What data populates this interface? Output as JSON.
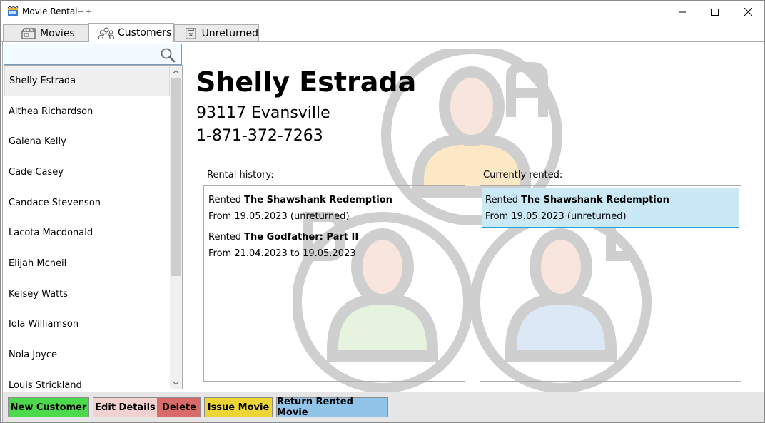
{
  "window": {
    "title": "Movie Rental++",
    "icon": "movie-rental-app-icon",
    "controls": [
      "minimize-icon",
      "maximize-icon",
      "close-icon"
    ]
  },
  "tabs": [
    {
      "label": "Movies",
      "icon": "movie-tab-icon",
      "active": false
    },
    {
      "label": "Customers",
      "icon": "customers-tab-icon",
      "active": true
    },
    {
      "label": "Unreturned",
      "icon": "unreturned-tab-icon",
      "active": false
    }
  ],
  "search": {
    "value": "",
    "placeholder": "",
    "icon": "search-icon"
  },
  "customers": [
    {
      "name": "Shelly Estrada",
      "selected": true
    },
    {
      "name": "Althea Richardson"
    },
    {
      "name": "Galena Kelly"
    },
    {
      "name": "Cade Casey"
    },
    {
      "name": "Candace Stevenson"
    },
    {
      "name": "Lacota Macdonald"
    },
    {
      "name": "Elijah Mcneil"
    },
    {
      "name": "Kelsey Watts"
    },
    {
      "name": "Iola Williamson"
    },
    {
      "name": "Nola Joyce"
    },
    {
      "name": "Louis Strickland"
    }
  ],
  "details": {
    "name": "Shelly Estrada",
    "address": "93117 Evansville",
    "phone": "1-871-372-7263",
    "history_label": "Rental history:",
    "current_label": "Currently rented:",
    "history": [
      {
        "prefix": "Rented ",
        "title": "The Shawshank Redemption",
        "period": "From 19.05.2023 (unreturned)"
      },
      {
        "prefix": "Rented ",
        "title": "The Godfather: Part II",
        "period": "From 21.04.2023 to 19.05.2023"
      }
    ],
    "current": [
      {
        "prefix": "Rented ",
        "title": "The Shawshank Redemption",
        "period": "From 19.05.2023 (unreturned)",
        "selected": true
      }
    ]
  },
  "buttons": {
    "new_customer": "New Customer",
    "edit_details": "Edit Details",
    "delete": "Delete",
    "issue_movie": "Issue Movie",
    "return_rented_movie": "Return Rented Movie"
  },
  "colors": {
    "new_customer": "#4cd94c",
    "edit_details": "#f4d1d1",
    "delete": "#d86a6a",
    "issue_movie": "#ecd534",
    "return_rented_movie": "#90c4e8",
    "selection": "#cbe8f6"
  }
}
